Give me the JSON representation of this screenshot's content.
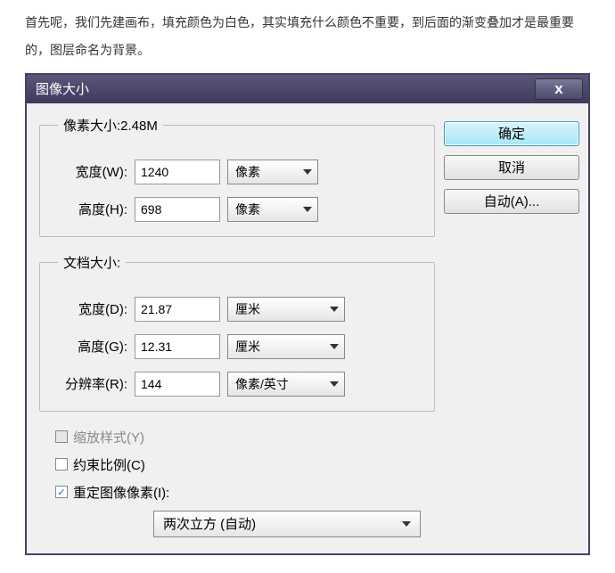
{
  "intro": "首先呢，我们先建画布，填充颜色为白色，其实填充什么颜色不重要，到后面的渐变叠加才是最重要的，图层命名为背景。",
  "dialog": {
    "title": "图像大小",
    "close": "x",
    "pixel_group": {
      "legend": "像素大小:2.48M",
      "width_label": "宽度(W):",
      "width_value": "1240",
      "width_unit": "像素",
      "height_label": "高度(H):",
      "height_value": "698",
      "height_unit": "像素"
    },
    "doc_group": {
      "legend": "文档大小:",
      "width_label": "宽度(D):",
      "width_value": "21.87",
      "width_unit": "厘米",
      "height_label": "高度(G):",
      "height_value": "12.31",
      "height_unit": "厘米",
      "res_label": "分辨率(R):",
      "res_value": "144",
      "res_unit": "像素/英寸"
    },
    "scale_styles": "缩放样式(Y)",
    "constrain": "约束比例(C)",
    "resample": "重定图像像素(I):",
    "resample_method": "两次立方 (自动)",
    "buttons": {
      "ok": "确定",
      "cancel": "取消",
      "auto": "自动(A)..."
    }
  }
}
